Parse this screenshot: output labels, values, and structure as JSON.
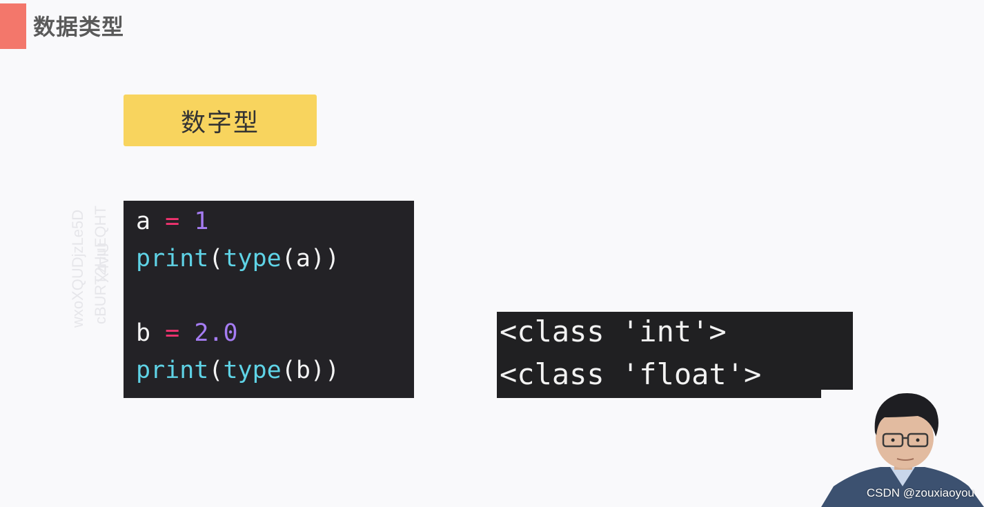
{
  "slide": {
    "title": "数据类型",
    "section_label": "数字型",
    "accent_color": "#f3776b",
    "tag_color": "#f8d45e"
  },
  "watermark": {
    "lines": [
      "wxoXQUDjzLe5D",
      "cBURT2HuEQHT",
      "X4vlU"
    ]
  },
  "code": {
    "line1": {
      "var": "a",
      "op": "=",
      "num": "1"
    },
    "line2": {
      "print": "print",
      "open1": "(",
      "type": "type",
      "open2": "(",
      "arg": "a",
      "close": "))"
    },
    "line3": {
      "var": "b",
      "op": "=",
      "num": "2.0"
    },
    "line4": {
      "print": "print",
      "open1": "(",
      "type": "type",
      "open2": "(",
      "arg": "b",
      "close": "))"
    }
  },
  "output": {
    "lines": [
      "<class 'int'>",
      "<class 'float'>"
    ]
  },
  "credit": "CSDN @zouxiaoyou",
  "colors": {
    "code_bg": "#232226",
    "operator": "#f0336f",
    "number": "#a57cf2",
    "function": "#5fd3e6"
  }
}
